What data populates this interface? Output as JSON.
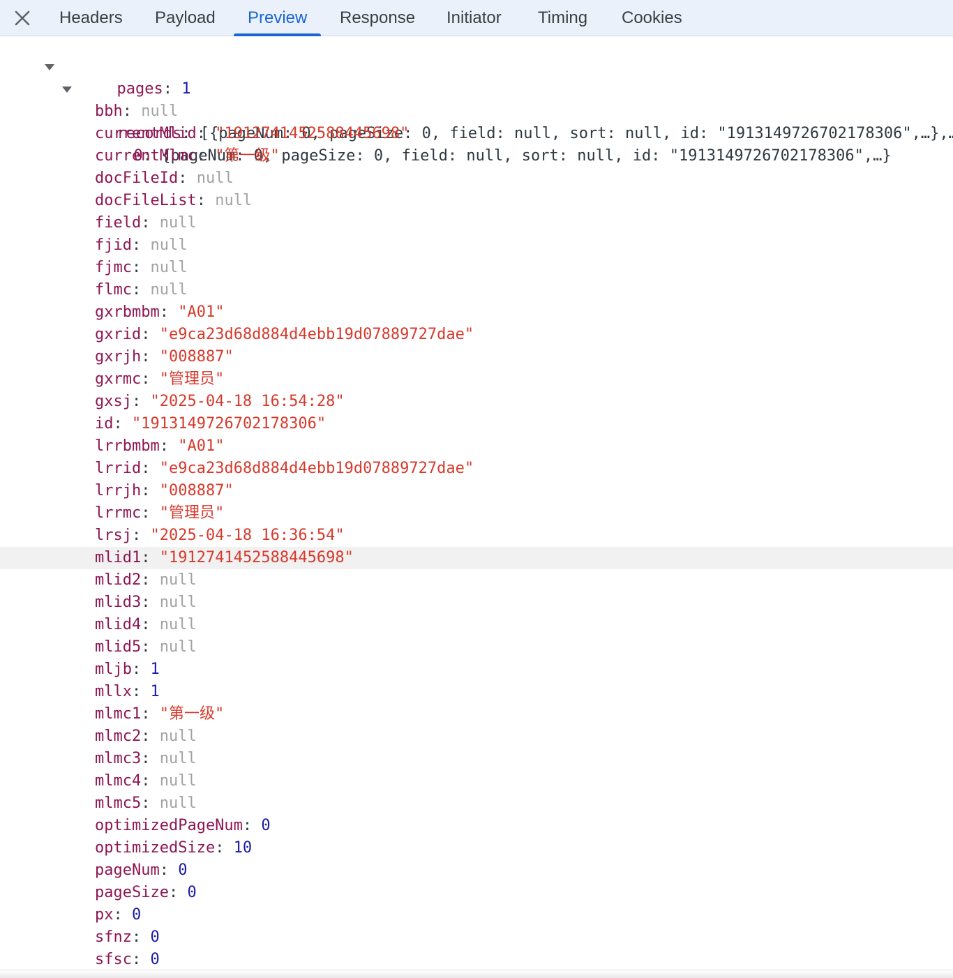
{
  "tabs": {
    "close_label": "close panel",
    "items": [
      {
        "label": "Headers"
      },
      {
        "label": "Payload"
      },
      {
        "label": "Preview"
      },
      {
        "label": "Response"
      },
      {
        "label": "Initiator"
      },
      {
        "label": "Timing"
      },
      {
        "label": "Cookies"
      }
    ],
    "active": "Preview"
  },
  "tree": {
    "pages": {
      "key": "pages",
      "value": "1"
    },
    "records": {
      "key": "records",
      "summary": "[{pageNum: 0, pageSize: 0, field: null, sort: null, id: \"1913149726702178306\",…},…]"
    },
    "record0": {
      "key": "0",
      "summary": "{pageNum: 0, pageSize: 0, field: null, sort: null, id: \"1913149726702178306\",…}"
    },
    "fields": [
      {
        "key": "bbh",
        "value": "null",
        "type": "null"
      },
      {
        "key": "currentMlid",
        "value": "\"1912741452588445698\"",
        "type": "str"
      },
      {
        "key": "currentMlmc",
        "value": "\"第一级\"",
        "type": "str"
      },
      {
        "key": "docFileId",
        "value": "null",
        "type": "null"
      },
      {
        "key": "docFileList",
        "value": "null",
        "type": "null"
      },
      {
        "key": "field",
        "value": "null",
        "type": "null"
      },
      {
        "key": "fjid",
        "value": "null",
        "type": "null"
      },
      {
        "key": "fjmc",
        "value": "null",
        "type": "null"
      },
      {
        "key": "flmc",
        "value": "null",
        "type": "null"
      },
      {
        "key": "gxrbmbm",
        "value": "\"A01\"",
        "type": "str"
      },
      {
        "key": "gxrid",
        "value": "\"e9ca23d68d884d4ebb19d07889727dae\"",
        "type": "str"
      },
      {
        "key": "gxrjh",
        "value": "\"008887\"",
        "type": "str"
      },
      {
        "key": "gxrmc",
        "value": "\"管理员\"",
        "type": "str"
      },
      {
        "key": "gxsj",
        "value": "\"2025-04-18 16:54:28\"",
        "type": "str"
      },
      {
        "key": "id",
        "value": "\"1913149726702178306\"",
        "type": "str"
      },
      {
        "key": "lrrbmbm",
        "value": "\"A01\"",
        "type": "str"
      },
      {
        "key": "lrrid",
        "value": "\"e9ca23d68d884d4ebb19d07889727dae\"",
        "type": "str"
      },
      {
        "key": "lrrjh",
        "value": "\"008887\"",
        "type": "str"
      },
      {
        "key": "lrrmc",
        "value": "\"管理员\"",
        "type": "str"
      },
      {
        "key": "lrsj",
        "value": "\"2025-04-18 16:36:54\"",
        "type": "str"
      },
      {
        "key": "mlid1",
        "value": "\"1912741452588445698\"",
        "type": "str",
        "highlighted": true
      },
      {
        "key": "mlid2",
        "value": "null",
        "type": "null"
      },
      {
        "key": "mlid3",
        "value": "null",
        "type": "null"
      },
      {
        "key": "mlid4",
        "value": "null",
        "type": "null"
      },
      {
        "key": "mlid5",
        "value": "null",
        "type": "null"
      },
      {
        "key": "mljb",
        "value": "1",
        "type": "num"
      },
      {
        "key": "mllx",
        "value": "1",
        "type": "num"
      },
      {
        "key": "mlmc1",
        "value": "\"第一级\"",
        "type": "str"
      },
      {
        "key": "mlmc2",
        "value": "null",
        "type": "null"
      },
      {
        "key": "mlmc3",
        "value": "null",
        "type": "null"
      },
      {
        "key": "mlmc4",
        "value": "null",
        "type": "null"
      },
      {
        "key": "mlmc5",
        "value": "null",
        "type": "null"
      },
      {
        "key": "optimizedPageNum",
        "value": "0",
        "type": "num"
      },
      {
        "key": "optimizedSize",
        "value": "10",
        "type": "num"
      },
      {
        "key": "pageNum",
        "value": "0",
        "type": "num"
      },
      {
        "key": "pageSize",
        "value": "0",
        "type": "num"
      },
      {
        "key": "px",
        "value": "0",
        "type": "num"
      },
      {
        "key": "sfnz",
        "value": "0",
        "type": "num"
      },
      {
        "key": "sfsc",
        "value": "0",
        "type": "num"
      }
    ]
  }
}
